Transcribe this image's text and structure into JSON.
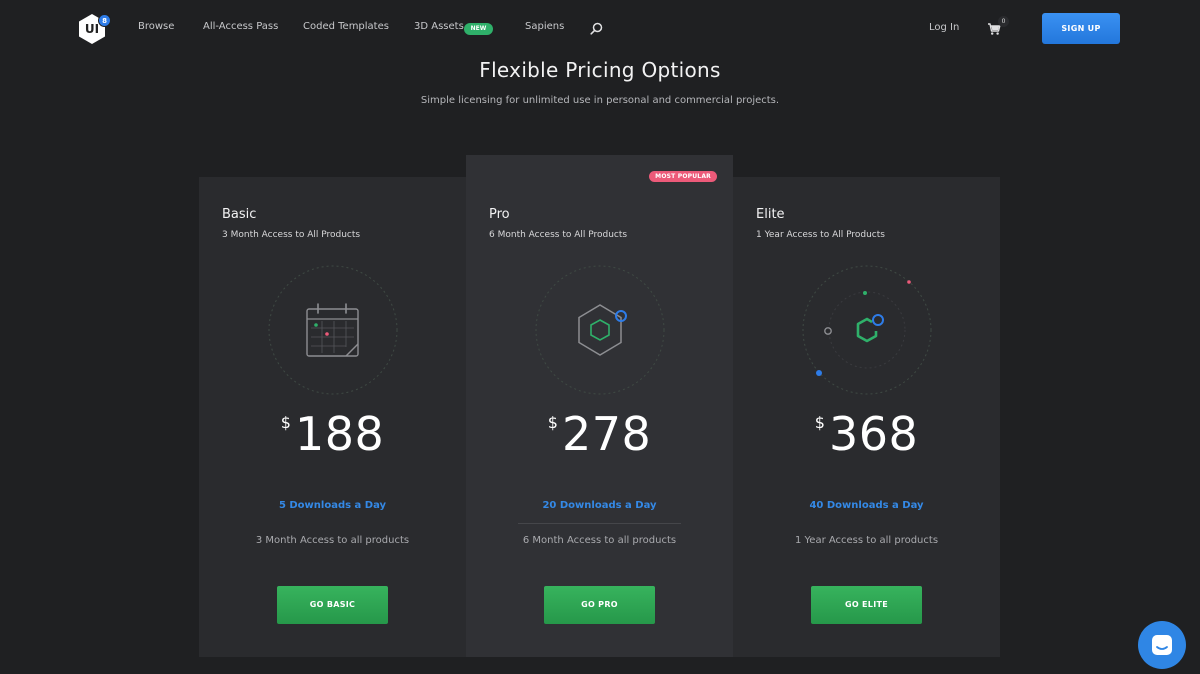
{
  "header": {
    "logo_text": "UI",
    "logo_badge": "8",
    "nav": [
      "Browse",
      "All-Access Pass",
      "Coded Templates",
      "3D Assets",
      "Sapiens"
    ],
    "new_badge": "NEW",
    "login": "Log In",
    "cart_count": "0",
    "signup": "SIGN UP"
  },
  "hero": {
    "title": "Flexible Pricing Options",
    "subtitle": "Simple licensing for unlimited use in personal and commercial projects."
  },
  "plans": [
    {
      "name": "Basic",
      "description": "3 Month Access to All Products",
      "currency": "$",
      "price": "188",
      "downloads": "5 Downloads a Day",
      "access": "3 Month Access to all products",
      "button": "GO BASIC"
    },
    {
      "name": "Pro",
      "badge": "MOST POPULAR",
      "description": "6 Month Access to All Products",
      "currency": "$",
      "price": "278",
      "downloads": "20 Downloads a Day",
      "access": "6 Month Access to all products",
      "button": "GO PRO"
    },
    {
      "name": "Elite",
      "description": "1 Year Access to All Products",
      "currency": "$",
      "price": "368",
      "downloads": "40 Downloads a Day",
      "access": "1 Year Access to all products",
      "button": "GO ELITE"
    }
  ],
  "icons": {
    "search": "search-icon",
    "cart": "cart-icon",
    "chat": "chat-icon",
    "basic_illustration": "calendar-icon",
    "pro_illustration": "hexagon-icon",
    "elite_illustration": "hexagon-orbit-icon"
  },
  "colors": {
    "background": "#1f2022",
    "card": "#2a2b2e",
    "card_featured": "#303135",
    "accent_blue": "#2e7ce8",
    "accent_green": "#2fb06a",
    "badge_pink": "#ec5a79"
  }
}
